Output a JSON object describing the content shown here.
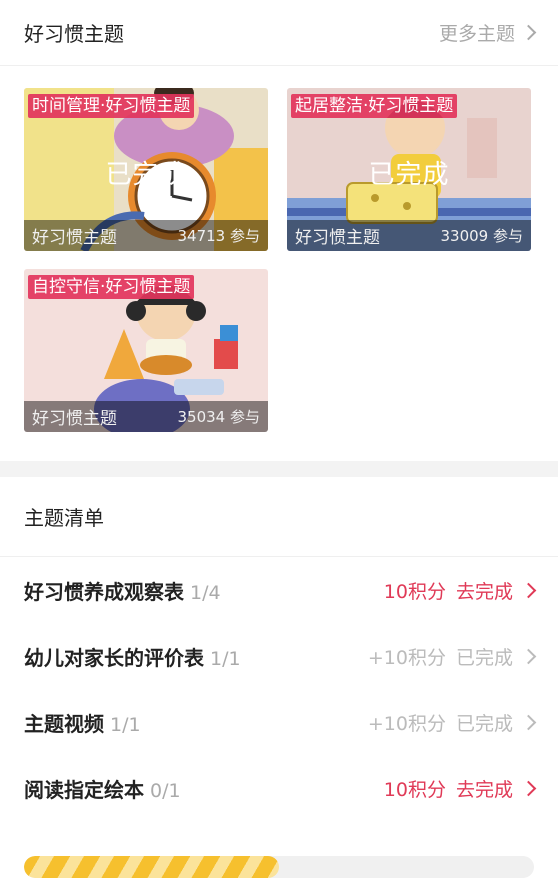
{
  "header": {
    "title": "好习惯主题",
    "more_label": "更多主题"
  },
  "cards": [
    {
      "tag": "时间管理·好习惯主题",
      "status": "已完成",
      "title": "好习惯主题",
      "count": "34713 参与"
    },
    {
      "tag": "起居整洁·好习惯主题",
      "status": "已完成",
      "title": "好习惯主题",
      "count": "33009 参与"
    },
    {
      "tag": "自控守信·好习惯主题",
      "status": "",
      "title": "好习惯主题",
      "count": "35034 参与"
    }
  ],
  "tasks": {
    "title": "主题清单",
    "items": [
      {
        "name": "好习惯养成观察表",
        "progress": "1/4",
        "points": "10积分",
        "action": "去完成",
        "state": "todo"
      },
      {
        "name": "幼儿对家长的评价表",
        "progress": "1/1",
        "points": "+10积分",
        "action": "已完成",
        "state": "done"
      },
      {
        "name": "主题视频",
        "progress": "1/1",
        "points": "+10积分",
        "action": "已完成",
        "state": "done"
      },
      {
        "name": "阅读指定绘本",
        "progress": "0/1",
        "points": "10积分",
        "action": "去完成",
        "state": "todo"
      }
    ]
  },
  "progress": {
    "fraction": 0.5
  },
  "colors": {
    "accent": "#e03a57",
    "muted": "#bbbbbb",
    "progress_fill": "#f6c02e"
  }
}
